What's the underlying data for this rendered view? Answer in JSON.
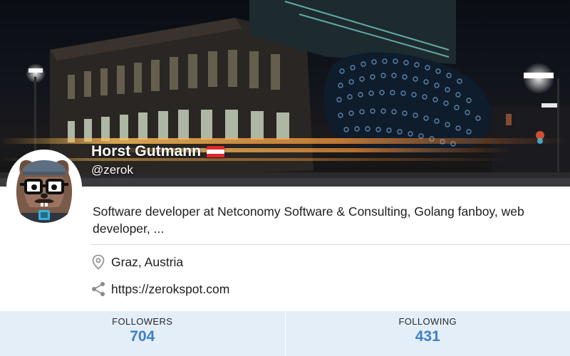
{
  "profile": {
    "name": "Horst Gutmann",
    "handle": "@zerok",
    "bio": "Software developer at Netconomy Software & Consulting, Golang fanboy, web developer, ...",
    "location": "Graz, Austria",
    "website": "https://zerokspot.com",
    "flag_colors": [
      "#e3262e",
      "#ffffff",
      "#e3262e"
    ]
  },
  "icons": {
    "location": "map-pin-icon",
    "website": "share-icon",
    "flag": "austria-flag-icon"
  },
  "stats": {
    "followers_label": "FOLLOWERS",
    "followers_value": "704",
    "following_label": "FOLLOWING",
    "following_value": "431"
  },
  "colors": {
    "stats_background": "#e4eef9",
    "stats_value": "#3c7fc8"
  }
}
